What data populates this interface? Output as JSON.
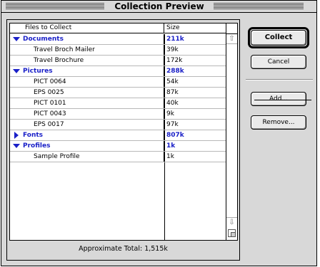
{
  "window": {
    "title": "Collection Preview"
  },
  "list": {
    "headers": {
      "name": "Files to Collect",
      "size": "Size"
    },
    "rows": [
      {
        "kind": "group",
        "expanded": true,
        "name": "Documents",
        "size": "211k"
      },
      {
        "kind": "item",
        "name": "Travel Broch Mailer",
        "size": "39k"
      },
      {
        "kind": "item",
        "name": "Travel Brochure",
        "size": "172k"
      },
      {
        "kind": "group",
        "expanded": true,
        "name": "Pictures",
        "size": "288k"
      },
      {
        "kind": "item",
        "name": "PICT 0064",
        "size": "54k"
      },
      {
        "kind": "item",
        "name": "EPS 0025",
        "size": "87k"
      },
      {
        "kind": "item",
        "name": "PICT 0101",
        "size": "40k"
      },
      {
        "kind": "item",
        "name": "PICT 0043",
        "size": "9k"
      },
      {
        "kind": "item",
        "name": "EPS 0017",
        "size": "97k"
      },
      {
        "kind": "group",
        "expanded": false,
        "name": "Fonts",
        "size": "807k"
      },
      {
        "kind": "group",
        "expanded": true,
        "name": "Profiles",
        "size": "1k"
      },
      {
        "kind": "item",
        "name": "Sample Profile",
        "size": "1k"
      }
    ],
    "total_label": "Approximate Total: 1,515k"
  },
  "buttons": {
    "collect": "Collect",
    "cancel": "Cancel",
    "add": "Add...",
    "remove": "Remove..."
  },
  "colors": {
    "group_text": "#1a20c8",
    "window_bg": "#d8d8d8"
  }
}
